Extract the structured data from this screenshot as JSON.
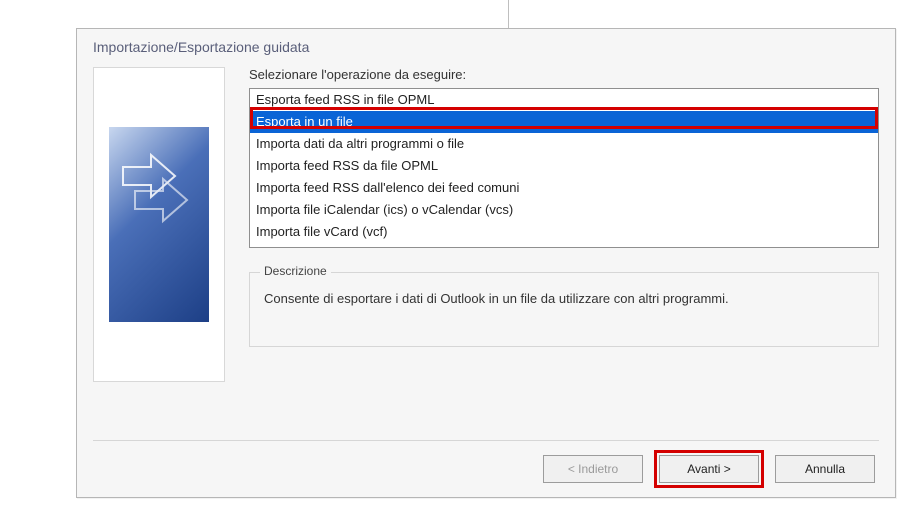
{
  "dialog": {
    "title": "Importazione/Esportazione guidata",
    "prompt": "Selezionare l'operazione da eseguire:",
    "options": [
      "Esporta feed RSS in file OPML",
      "Esporta in un file",
      "Importa dati da altri programmi o file",
      "Importa feed RSS da file OPML",
      "Importa feed RSS dall'elenco dei feed comuni",
      "Importa file iCalendar (ics) o vCalendar (vcs)",
      "Importa file vCard (vcf)"
    ],
    "selected_index": 1,
    "description_label": "Descrizione",
    "description_text": "Consente di esportare i dati di Outlook in un file da utilizzare con altri programmi.",
    "buttons": {
      "back": "< Indietro",
      "next": "Avanti >",
      "cancel": "Annulla"
    }
  }
}
